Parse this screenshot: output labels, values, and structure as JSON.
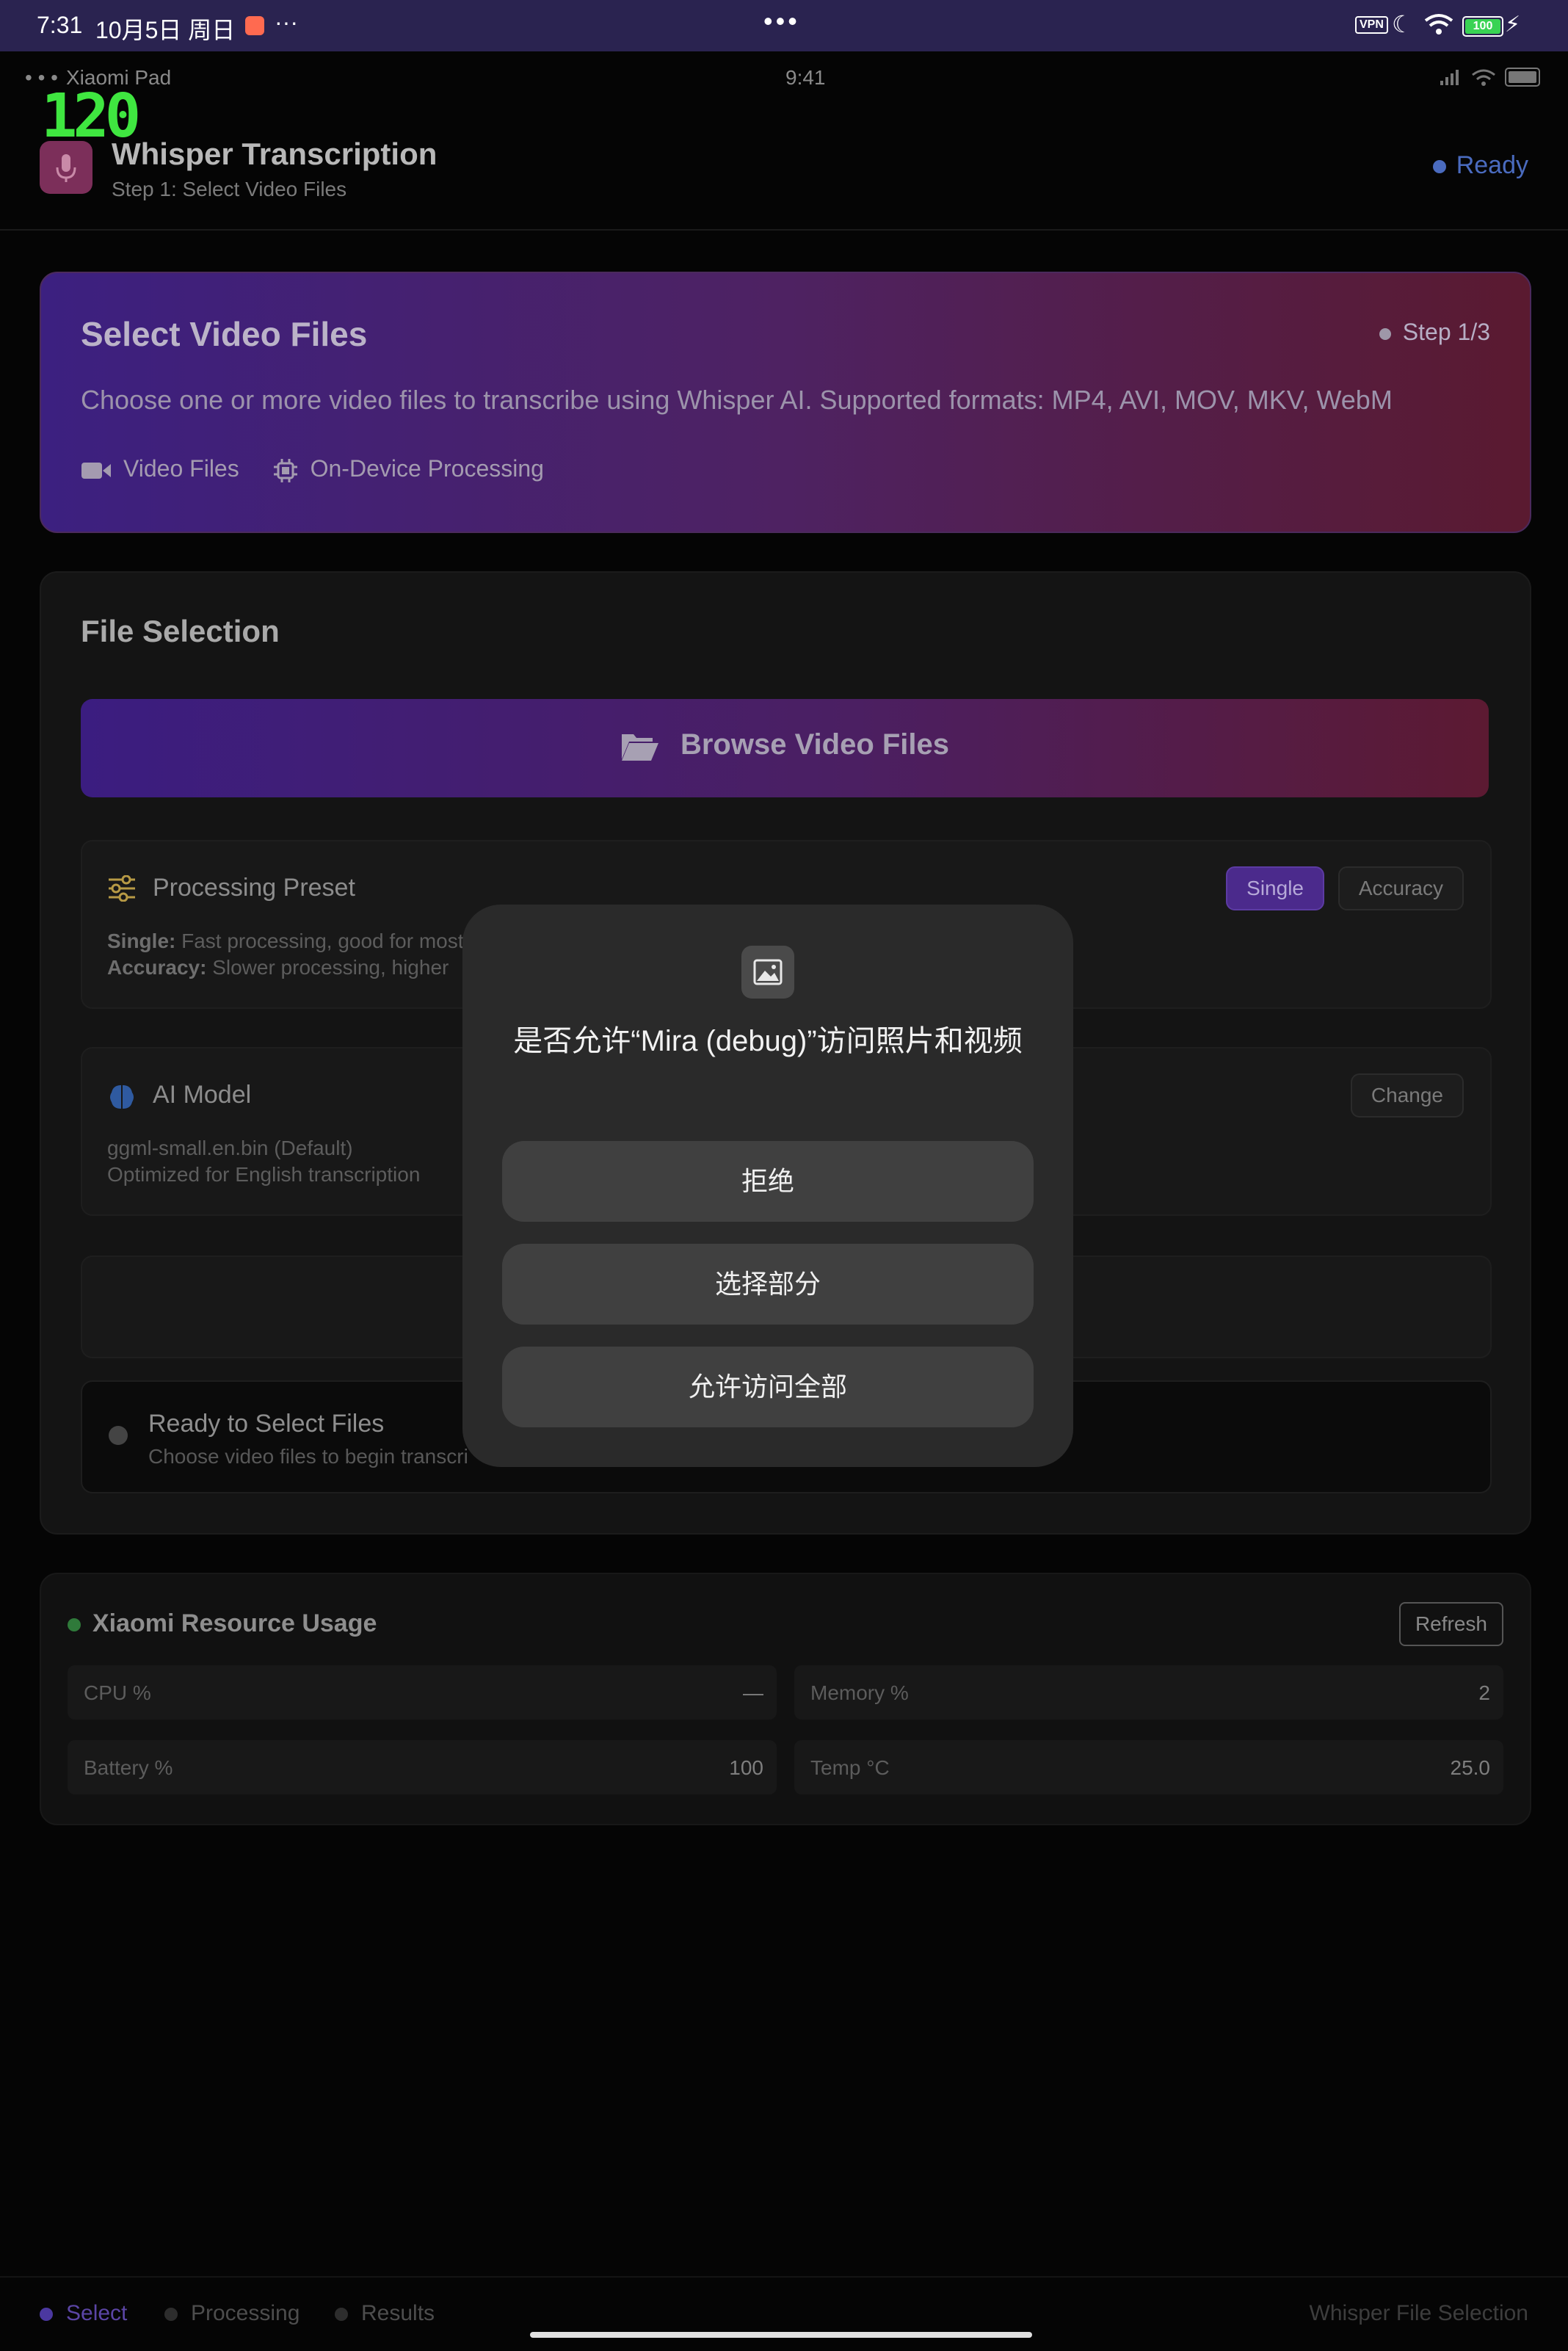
{
  "system_bar": {
    "time": "7:31",
    "date": "10月5日 周日",
    "more": "···",
    "center_dots": "•••",
    "vpn": "VPN",
    "battery_level": "100"
  },
  "device_strip": {
    "device_name": "Xiaomi Pad",
    "time": "9:41",
    "fps": "120"
  },
  "header": {
    "title": "Whisper Transcription",
    "subtitle": "Step 1: Select Video Files",
    "status": "Ready"
  },
  "hero": {
    "title": "Select Video Files",
    "step": "Step 1/3",
    "description": "Choose one or more video files to transcribe using Whisper AI. Supported formats: MP4, AVI, MOV, MKV, WebM",
    "tag_video": "Video Files",
    "tag_device": "On-Device Processing"
  },
  "file_selection": {
    "title": "File Selection",
    "browse_label": "Browse Video Files",
    "preset": {
      "title": "Processing Preset",
      "single_chip": "Single",
      "accuracy_chip": "Accuracy",
      "single_label": "Single:",
      "single_desc": "Fast processing, good for most",
      "accuracy_label": "Accuracy:",
      "accuracy_desc": "Slower processing, higher"
    },
    "model": {
      "title": "AI Model",
      "change": "Change",
      "file": "ggml-small.en.bin (Default)",
      "desc": "Optimized for English transcription"
    },
    "ready": {
      "title": "Ready to Select Files",
      "subtitle": "Choose video files to begin transcri"
    }
  },
  "resources": {
    "title": "Xiaomi Resource Usage",
    "refresh": "Refresh",
    "stats": [
      {
        "label": "CPU %",
        "value": "—"
      },
      {
        "label": "Memory %",
        "value": "2"
      },
      {
        "label": "Battery %",
        "value": "100"
      },
      {
        "label": "Temp °C",
        "value": "25.0"
      }
    ]
  },
  "bottom_nav": {
    "items": [
      "Select",
      "Processing",
      "Results"
    ],
    "right_label": "Whisper File Selection"
  },
  "dialog": {
    "title": "是否允许“Mira (debug)”访问照片和视频",
    "deny": "拒绝",
    "select_some": "选择部分",
    "allow_all": "允许访问全部"
  }
}
